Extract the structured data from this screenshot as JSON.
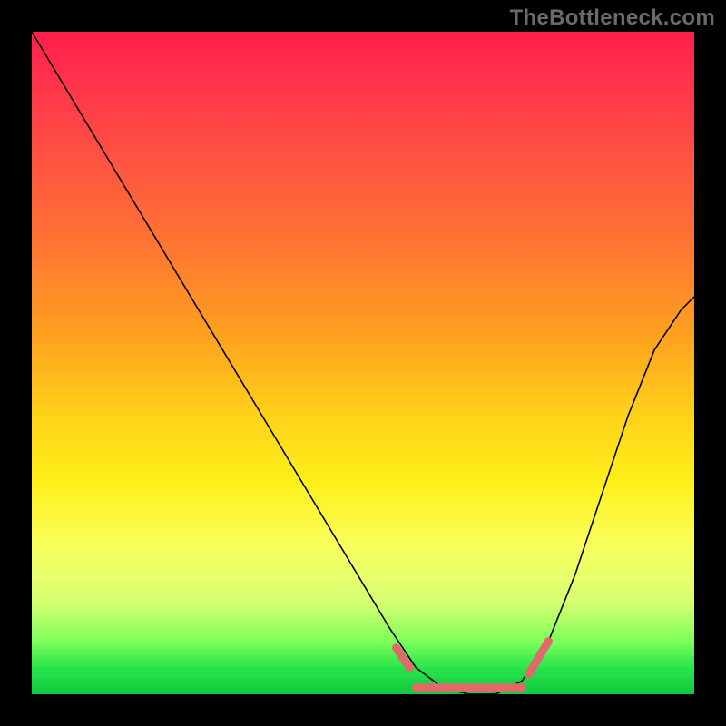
{
  "watermark": "TheBottleneck.com",
  "colors": {
    "frame": "#000000",
    "watermark": "#6a6a6a",
    "curve": "#000000",
    "accent": "#e06a6a"
  },
  "chart_data": {
    "type": "line",
    "title": "",
    "xlabel": "",
    "ylabel": "",
    "xlim": [
      0,
      100
    ],
    "ylim": [
      0,
      100
    ],
    "grid": false,
    "legend": false,
    "series": [
      {
        "name": "bottleneck-curve",
        "x": [
          0,
          6,
          12,
          18,
          24,
          30,
          36,
          42,
          48,
          54,
          58,
          62,
          66,
          70,
          74,
          78,
          82,
          86,
          90,
          94,
          98,
          100
        ],
        "y": [
          100,
          90,
          80,
          70,
          60,
          50,
          40,
          30,
          20,
          10,
          4,
          1,
          0,
          0,
          2,
          8,
          18,
          30,
          42,
          52,
          58,
          60
        ]
      }
    ],
    "accent_segments": [
      {
        "name": "left-tick",
        "x": [
          55,
          57
        ],
        "y": [
          7,
          4
        ]
      },
      {
        "name": "floor",
        "x": [
          58,
          74
        ],
        "y": [
          1,
          1
        ]
      },
      {
        "name": "right-tick",
        "x": [
          75,
          78
        ],
        "y": [
          3,
          8
        ]
      }
    ],
    "notes": "Values estimated from pixel positions; y runs 0 at bottom (green) to 100 at top (red)."
  }
}
